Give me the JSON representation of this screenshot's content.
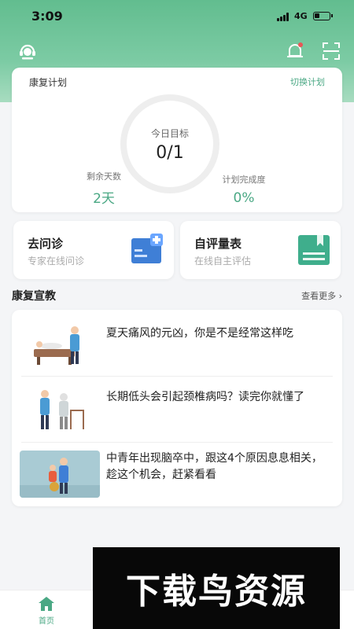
{
  "status_bar": {
    "time": "3:09",
    "network": "4G",
    "battery_level": 0.35
  },
  "plan": {
    "title": "康复计划",
    "switch_label": "切换计划",
    "today_goal_label": "今日目标",
    "today_goal_value": "0/1",
    "days_left_label": "剩余天数",
    "days_left_value": "2天",
    "completion_label": "计划完成度",
    "completion_value": "0%"
  },
  "services": [
    {
      "title": "去问诊",
      "subtitle": "专家在线问诊",
      "icon": "clipboard-plus-icon"
    },
    {
      "title": "自评量表",
      "subtitle": "在线自主评估",
      "icon": "bookmark-form-icon"
    }
  ],
  "education": {
    "title": "康复宣教",
    "more_label": "查看更多 ›",
    "articles": [
      {
        "title": "夏天痛风的元凶，你是不是经常这样吃"
      },
      {
        "title": "长期低头会引起颈椎病吗？读完你就懂了"
      },
      {
        "title": "中青年出现脑卒中，跟这4个原因息息相关，趁这个机会，赶紧看看"
      }
    ]
  },
  "tabbar": {
    "home_label": "首页"
  },
  "watermark": {
    "text": "下载鸟资源"
  },
  "colors": {
    "accent": "#4aa884",
    "header_green": "#62bd8f"
  }
}
